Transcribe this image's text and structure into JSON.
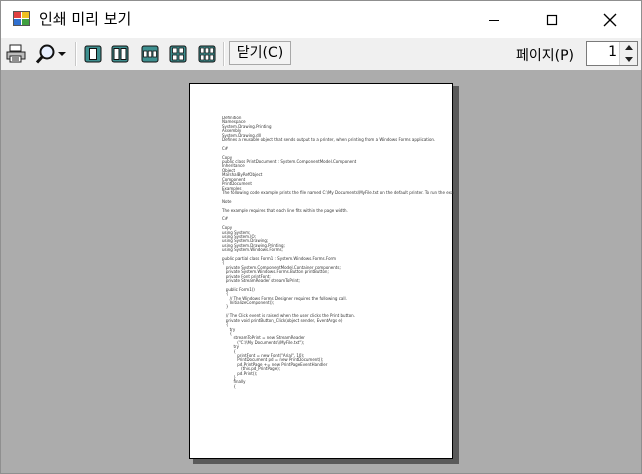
{
  "window": {
    "title": "인쇄 미리 보기"
  },
  "toolbar": {
    "print_icon": "printer-icon",
    "zoom_icon": "magnifier-icon",
    "layouts": [
      "one-page-icon",
      "two-pages-icon",
      "three-pages-icon",
      "four-pages-icon",
      "six-pages-icon"
    ],
    "close_label": "닫기(C)",
    "page_label": "페이지(P)",
    "page_value": "1"
  },
  "document": {
    "lines": [
      "Definition",
      "Namespace",
      "System.Drawing.Printing",
      "Assembly",
      "System.Drawing.dll",
      "Defines a reusable object that sends output to a printer, when printing from a Windows Forms application.",
      "",
      "C#",
      "",
      "Copy",
      "public class PrintDocument : System.ComponentModel.Component",
      "Inheritance",
      "Object",
      "MarshalByRefObject",
      "Component",
      "PrintDocument",
      "Examples",
      "The following code example prints the file named C:\\My Documents\\MyFile.txt on the default printer. To run the example",
      "",
      "Note",
      "",
      "The example requires that each line fits within the page width.",
      "",
      "C#",
      "",
      "Copy",
      "using System;",
      "using System.IO;",
      "using System.Drawing;",
      "using System.Drawing.Printing;",
      "using System.Windows.Forms;",
      "",
      "public partial class Form1 : System.Windows.Forms.Form",
      "{",
      "   private System.ComponentModel.Container components;",
      "   private System.Windows.Forms.Button printButton;",
      "   private Font printFont;",
      "   private StreamReader streamToPrint;",
      "",
      "   public Form1()",
      "   {",
      "      // The Windows Forms Designer requires the following call.",
      "      InitializeComponent();",
      "   }",
      "",
      "   // The Click event is raised when the user clicks the Print button.",
      "   private void printButton_Click(object sender, EventArgs e)",
      "   {",
      "      try",
      "      {",
      "         streamToPrint = new StreamReader",
      "            (\"C:\\\\My Documents\\\\MyFile.txt\");",
      "         try",
      "         {",
      "            printFont = new Font(\"Arial\", 10);",
      "            PrintDocument pd = new PrintDocument();",
      "            pd.PrintPage += new PrintPageEventHandler",
      "               (this.pd_PrintPage);",
      "            pd.Print();",
      "         }",
      "         finally",
      "         {"
    ]
  }
}
